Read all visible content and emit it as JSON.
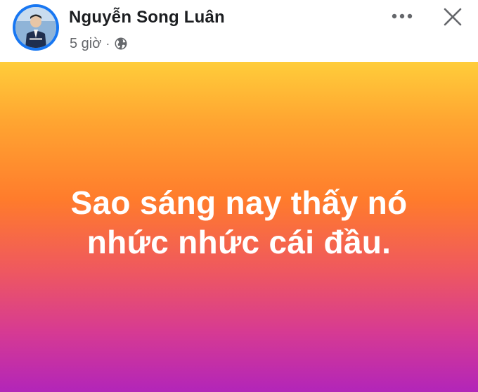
{
  "post": {
    "author_name": "Nguyễn Song Luân",
    "timestamp": "5 giờ",
    "separator": "·",
    "privacy_icon": "globe-icon",
    "more_icon": "more-horizontal-icon",
    "close_icon": "close-icon",
    "status_lines": [
      "Sao sáng nay thấy nó",
      "nhức nhức cái đầu."
    ]
  },
  "colors": {
    "accent": "#1877f2",
    "name_text": "#1c1e21",
    "meta_text": "#65676b",
    "gradient_top": "#ffcd3a",
    "gradient_mid": "#ff7b2c",
    "gradient_bottom": "#b225b9",
    "status_text": "#ffffff"
  }
}
